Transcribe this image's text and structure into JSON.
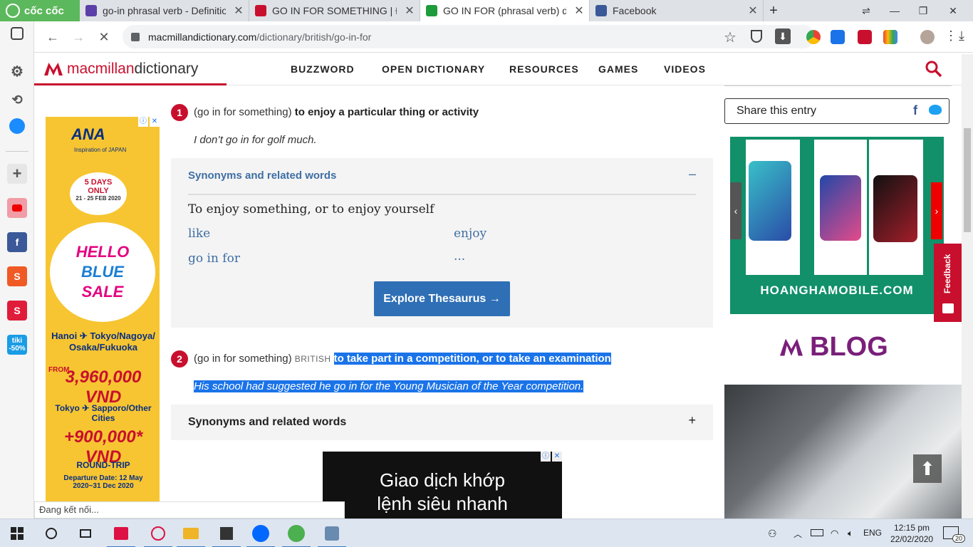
{
  "browser": {
    "brand": "cốc cốc",
    "tabs": [
      {
        "title": "go-in phrasal verb - Definition",
        "favicon_color": "#5b3fa8"
      },
      {
        "title": "GO IN FOR SOMETHING | Định",
        "favicon_color": "#c8102e"
      },
      {
        "title": "GO IN FOR (phrasal verb) def",
        "favicon_color": "#1e9c3a"
      },
      {
        "title": "Facebook",
        "favicon_color": "#3b5998"
      }
    ],
    "url_host": "macmillandictionary.com",
    "url_path": "/dictionary/british/go-in-for",
    "status_text": "Đang kết nối..."
  },
  "site": {
    "logo_part1": "macmillan",
    "logo_part2": "dictionary",
    "menu": [
      "BUZZWORD",
      "OPEN DICTIONARY",
      "RESOURCES",
      "GAMES",
      "VIDEOS"
    ]
  },
  "entry": {
    "senses": [
      {
        "number": "1",
        "phrase": "(go in for something)",
        "region": "",
        "definition": "to enjoy a particular thing or activity",
        "example": "I don’t go in for golf much."
      },
      {
        "number": "2",
        "phrase": "(go in for something)",
        "region": "BRITISH",
        "definition": "to take part in a competition, or to take an examination",
        "example": "His school had suggested he go in for the Young Musician of the Year competition."
      }
    ],
    "synonyms_heading": "Synonyms and related words",
    "synonyms_collapse": "–",
    "synonyms_expand": "+",
    "synonyms_title": "To enjoy something, or to enjoy yourself",
    "synonyms_words": [
      "like",
      "enjoy",
      "go in for",
      "..."
    ],
    "thesaurus_button": "Explore Thesaurus →"
  },
  "ads": {
    "left": {
      "brand": "ANA",
      "brand_sub": "Inspiration of JAPAN",
      "days_line1": "5 DAYS",
      "days_line2": "ONLY",
      "days_dates": "21 - 25 FEB 2020",
      "hello_line1": "HELLO",
      "hello_line2": "BLUE",
      "hello_line3": "SALE",
      "route1": "Hanoi ✈ Tokyo/Nagoya/ Osaka/Fukuoka",
      "price1_from": "FROM",
      "price1": "3,960,000 VND",
      "route2": "Tokyo ✈ Sapporo/Other Cities",
      "price2": "+900,000* VND",
      "trip": "ROUND-TRIP",
      "departure": "Departure Date: 12 May 2020~31 Dec 2020"
    },
    "bottom": {
      "line1": "Giao dịch khớp",
      "line2": "lệnh siêu nhanh"
    },
    "right": {
      "brand": "HOANGHAMOBILE.COM"
    }
  },
  "sidebar_right": {
    "share_label": "Share this entry",
    "fb_glyph": "f",
    "feedback_label": "Feedback",
    "blog_label": "BLOG"
  },
  "taskbar": {
    "language": "ENG",
    "time": "12:15 pm",
    "date": "22/02/2020",
    "notifications": "20"
  }
}
